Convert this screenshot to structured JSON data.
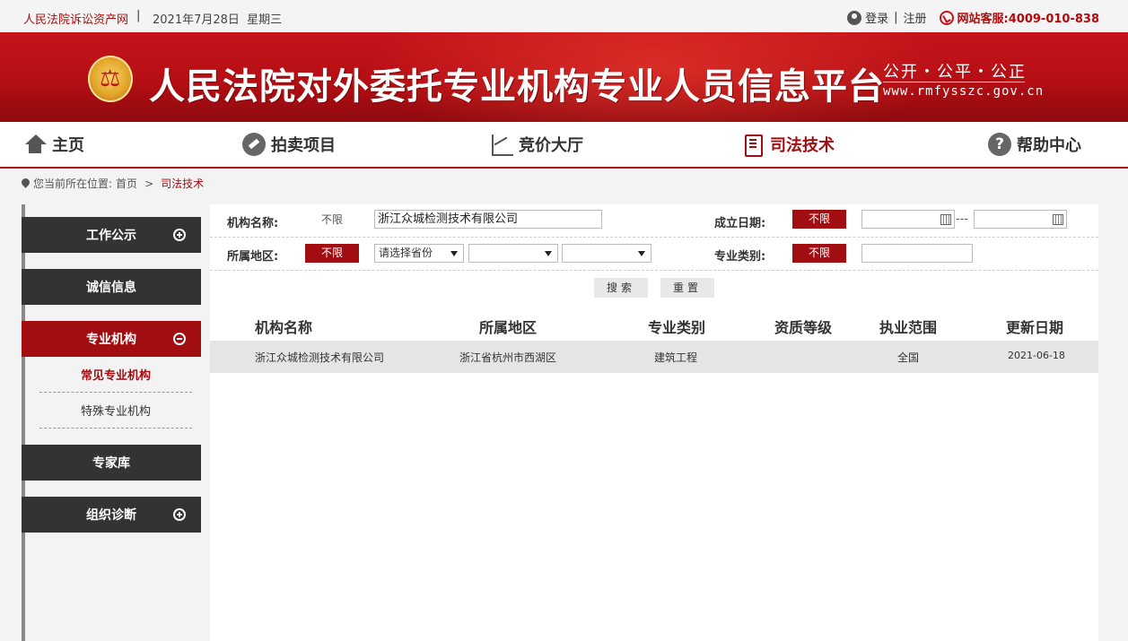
{
  "topbar": {
    "site_name": "人民法院诉讼资产网",
    "separator": "|",
    "date": "2021年7月28日",
    "weekday": "星期三",
    "login": "登录",
    "divider": "|",
    "register": "注册",
    "hotline": "网站客服:4009-010-838"
  },
  "banner": {
    "title": "人民法院对外委托专业机构专业人员信息平台",
    "slogan": "公开・公平・公正",
    "url": "www.rmfysszc.gov.cn"
  },
  "nav": {
    "items": [
      {
        "label": "主页",
        "icon": "home-icon"
      },
      {
        "label": "拍卖项目",
        "icon": "auction-icon"
      },
      {
        "label": "竞价大厅",
        "icon": "chart-icon"
      },
      {
        "label": "司法技术",
        "icon": "book-icon"
      },
      {
        "label": "帮助中心",
        "icon": "help-icon"
      }
    ],
    "active_index": 3
  },
  "breadcrumb": {
    "prefix": "您当前所在位置:",
    "home": "首页",
    "sep": ">",
    "current": "司法技术"
  },
  "sidebar": {
    "items": [
      {
        "label": "工作公示",
        "toggle": "plus"
      },
      {
        "label": "诚信信息"
      },
      {
        "label": "专业机构",
        "toggle": "minus",
        "active": true
      },
      {
        "label": "专家库"
      },
      {
        "label": "组织诊断",
        "toggle": "plus"
      }
    ],
    "submenu": [
      {
        "label": "常见专业机构",
        "active": true
      },
      {
        "label": "特殊专业机构"
      }
    ]
  },
  "filters": {
    "org_name_label": "机构名称:",
    "org_name_unlimited": "不限",
    "org_name_value": "浙江众城检测技术有限公司",
    "founded_label": "成立日期:",
    "founded_unlimited": "不限",
    "founded_from": "",
    "founded_to": "",
    "date_separator": "---",
    "region_label": "所属地区:",
    "region_unlimited": "不限",
    "province_placeholder": "请选择省份",
    "city_value": "",
    "district_value": "",
    "category_label": "专业类别:",
    "category_unlimited": "不限",
    "category_value": "",
    "search_button": "搜索",
    "reset_button": "重置"
  },
  "table": {
    "columns": [
      "机构名称",
      "所属地区",
      "专业类别",
      "资质等级",
      "执业范围",
      "更新日期"
    ],
    "rows": [
      {
        "name": "浙江众城检测技术有限公司",
        "region": "浙江省杭州市西湖区",
        "category": "建筑工程",
        "qualification": "",
        "scope": "全国",
        "updated": "2021-06-18"
      }
    ]
  },
  "colors": {
    "brand_red": "#a20d12",
    "sidebar_dark": "#333333"
  }
}
